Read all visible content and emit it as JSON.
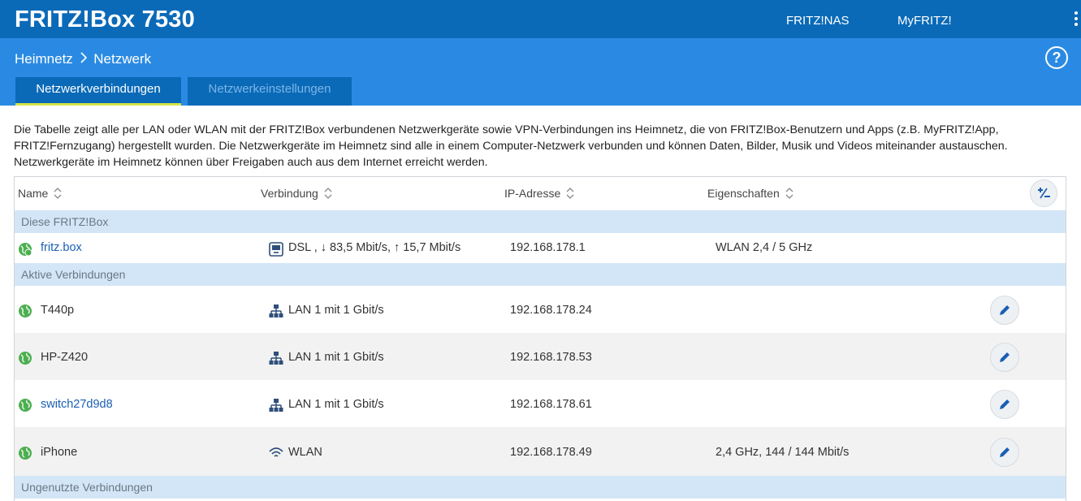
{
  "header": {
    "brand": "FRITZ!Box 7530",
    "links": [
      "FRITZ!NAS",
      "MyFRITZ!"
    ]
  },
  "breadcrumb": {
    "parent": "Heimnetz",
    "current": "Netzwerk"
  },
  "tabs": [
    {
      "label": "Netzwerkverbindungen",
      "active": true
    },
    {
      "label": "Netzwerkeinstellungen",
      "active": false
    }
  ],
  "intro_text": "Die Tabelle zeigt alle per LAN oder WLAN mit der FRITZ!Box verbundenen Netzwerkgeräte sowie VPN-Verbindungen ins Heimnetz, die von FRITZ!Box-Benutzern und Apps (z.B. MyFRITZ!App, FRITZ!Fernzugang) hergestellt wurden. Die Netzwerkgeräte im Heimnetz sind alle in einem Computer-Netzwerk verbunden und können Daten, Bilder, Musik und Videos miteinander austauschen. Netzwerkgeräte im Heimnetz können über Freigaben auch aus dem Internet erreicht werden.",
  "table": {
    "columns": [
      "Name",
      "Verbindung",
      "IP-Adresse",
      "Eigenschaften"
    ],
    "groups": {
      "this_box": "Diese FRITZ!Box",
      "active": "Aktive Verbindungen",
      "unused": "Ungenutzte Verbindungen"
    },
    "box_row": {
      "name": "fritz.box",
      "connection": "DSL , ↓ 83,5 Mbit/s, ↑ 15,7 Mbit/s",
      "ip": "192.168.178.1",
      "properties": "WLAN 2,4 / 5 GHz"
    },
    "active_rows": [
      {
        "name": "T440p",
        "connection": "LAN 1 mit 1 Gbit/s",
        "ip": "192.168.178.24",
        "properties": "",
        "conn_icon": "lan-icon"
      },
      {
        "name": "HP-Z420",
        "connection": "LAN 1 mit 1 Gbit/s",
        "ip": "192.168.178.53",
        "properties": "",
        "conn_icon": "lan-icon"
      },
      {
        "name": "switch27d9d8",
        "connection": "LAN 1 mit 1 Gbit/s",
        "ip": "192.168.178.61",
        "properties": "",
        "conn_icon": "lan-icon"
      },
      {
        "name": "iPhone",
        "connection": "WLAN",
        "ip": "192.168.178.49",
        "properties": "2,4 GHz, 144 / 144 Mbit/s",
        "conn_icon": "wifi-icon"
      }
    ]
  },
  "colors": {
    "topbar": "#0a6ab8",
    "navbar": "#2a8ae3",
    "group_bg": "#d3e6f7",
    "link": "#1a5fb4",
    "online": "#4caf50",
    "tab_underline": "#d7e34a"
  }
}
